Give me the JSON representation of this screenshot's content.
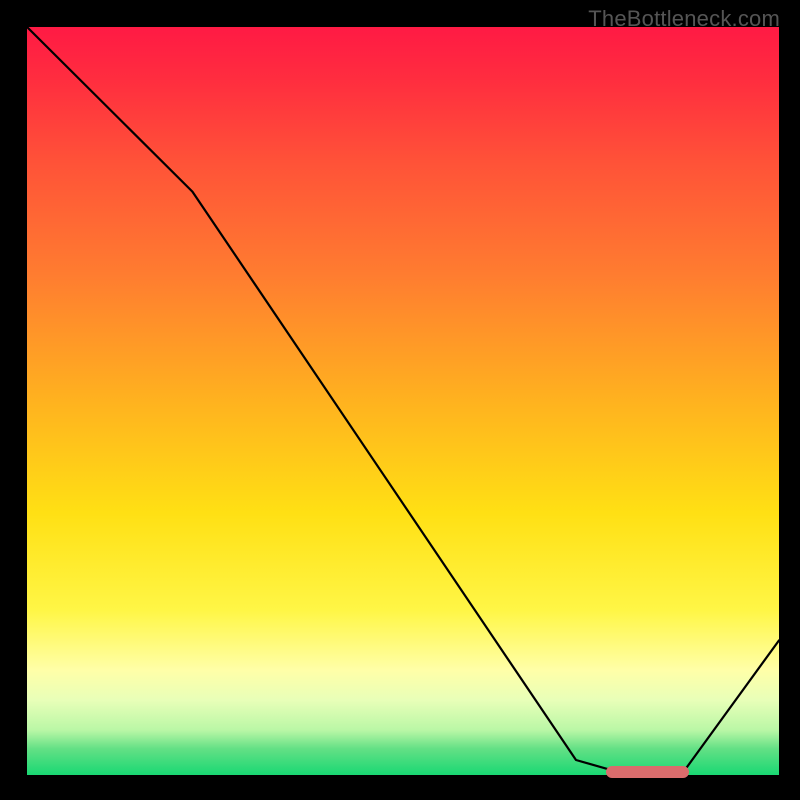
{
  "watermark": "TheBottleneck.com",
  "chart_data": {
    "type": "line",
    "title": "",
    "xlabel": "",
    "ylabel": "",
    "xlim": [
      0,
      100
    ],
    "ylim": [
      0,
      100
    ],
    "background_gradient": {
      "stops": [
        {
          "offset": 0.0,
          "color": "#ff1a44"
        },
        {
          "offset": 0.07,
          "color": "#ff2d3f"
        },
        {
          "offset": 0.18,
          "color": "#ff5238"
        },
        {
          "offset": 0.33,
          "color": "#ff7c30"
        },
        {
          "offset": 0.5,
          "color": "#ffb21f"
        },
        {
          "offset": 0.65,
          "color": "#ffe014"
        },
        {
          "offset": 0.78,
          "color": "#fff646"
        },
        {
          "offset": 0.86,
          "color": "#ffffa8"
        },
        {
          "offset": 0.9,
          "color": "#e8ffb8"
        },
        {
          "offset": 0.94,
          "color": "#baf7a6"
        },
        {
          "offset": 0.965,
          "color": "#63e085"
        },
        {
          "offset": 1.0,
          "color": "#19d873"
        }
      ]
    },
    "series": [
      {
        "name": "bottleneck-curve",
        "color": "#000000",
        "x": [
          0,
          22,
          73,
          80,
          87,
          100
        ],
        "y": [
          100,
          78,
          2,
          0,
          0,
          18
        ]
      }
    ],
    "optimal_marker": {
      "x_start": 77,
      "x_end": 88,
      "y": 0,
      "color": "#d96c6c"
    }
  }
}
